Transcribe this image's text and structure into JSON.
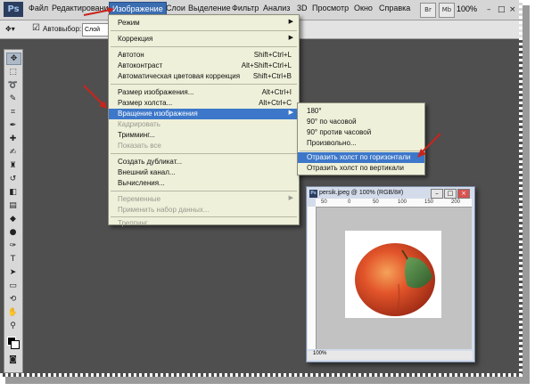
{
  "app": {
    "logo": "Ps",
    "zoom": "100%"
  },
  "menubar": {
    "items": [
      "Файл",
      "Редактирование",
      "Изображение",
      "Слои",
      "Выделение",
      "Фильтр",
      "Анализ",
      "3D",
      "Просмотр",
      "Окно",
      "Справка"
    ],
    "active": "Изображение"
  },
  "toolbar_buttons": [
    "Br",
    "Mb"
  ],
  "window_controls": {
    "minimize": "–",
    "maximize": "□",
    "close": "×"
  },
  "options_bar": {
    "autoselect_label": "Автовыбор:",
    "layer_value": "Слой"
  },
  "image_menu": [
    {
      "label": "Режим",
      "arrow": true
    },
    {
      "sep": true
    },
    {
      "label": "Коррекция",
      "arrow": true
    },
    {
      "sep": true
    },
    {
      "label": "Автотон",
      "shortcut": "Shift+Ctrl+L"
    },
    {
      "label": "Автоконтраст",
      "shortcut": "Alt+Shift+Ctrl+L"
    },
    {
      "label": "Автоматическая цветовая коррекция",
      "shortcut": "Shift+Ctrl+B"
    },
    {
      "sep": true
    },
    {
      "label": "Размер изображения...",
      "shortcut": "Alt+Ctrl+I"
    },
    {
      "label": "Размер холста...",
      "shortcut": "Alt+Ctrl+C"
    },
    {
      "label": "Вращение изображения",
      "arrow": true,
      "highlight": true
    },
    {
      "label": "Кадрировать",
      "disabled": true
    },
    {
      "label": "Тримминг..."
    },
    {
      "label": "Показать все",
      "disabled": true
    },
    {
      "sep": true
    },
    {
      "label": "Создать дубликат..."
    },
    {
      "label": "Внешний канал..."
    },
    {
      "label": "Вычисления..."
    },
    {
      "sep": true
    },
    {
      "label": "Переменные",
      "arrow": true,
      "disabled": true
    },
    {
      "label": "Применить набор данных...",
      "disabled": true
    },
    {
      "sep": true
    },
    {
      "label": "Треппинг...",
      "disabled": true
    }
  ],
  "rotate_submenu": [
    {
      "label": "180°"
    },
    {
      "label": "90° по часовой"
    },
    {
      "label": "90° против часовой"
    },
    {
      "label": "Произвольно..."
    },
    {
      "sep": true
    },
    {
      "label": "Отразить холст по горизонтали",
      "highlight": true
    },
    {
      "label": "Отразить холст по вертикали"
    }
  ],
  "document": {
    "title": "persik.jpeg @ 100% (RGB/8#)",
    "ruler_ticks": [
      "50",
      "0",
      "50",
      "100",
      "150",
      "200"
    ],
    "status_zoom": "100%"
  },
  "colors": {
    "accent": "#3d77c9",
    "menu_bg": "#eef0d9",
    "workspace": "#4f4f4f",
    "arrow_red": "#c8241c"
  }
}
